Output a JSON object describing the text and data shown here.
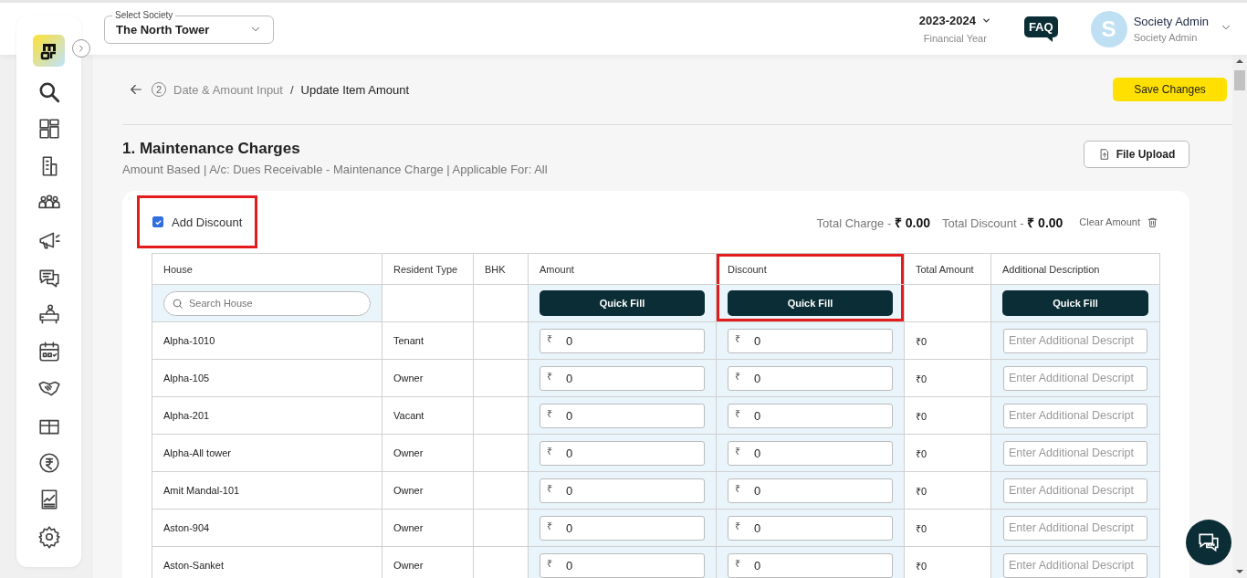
{
  "header": {
    "society_select": {
      "label": "Select Society",
      "value": "The North Tower"
    },
    "year": {
      "value": "2023-2024",
      "caption": "Financial Year"
    },
    "faq": "FAQ",
    "user": {
      "initial": "S",
      "name": "Society Admin",
      "role": "Society Admin"
    }
  },
  "breadcrumb": {
    "step": "2",
    "parent": "Date & Amount Input",
    "separator": "/",
    "current": "Update Item Amount"
  },
  "save_button": "Save Changes",
  "section": {
    "title": "1. Maintenance Charges",
    "subtitle": "Amount Based | A/c: Dues Receivable - Maintenance Charge | Applicable For: All",
    "file_upload": "File Upload"
  },
  "add_discount": {
    "label": "Add Discount",
    "checked": true,
    "highlighted": true
  },
  "totals": {
    "charge": "Total Charge - **₹ 0.00**",
    "discount": "Total Discount - **₹ 0.00**",
    "clear": "Clear Amount"
  },
  "table": {
    "columns": [
      {
        "label": "House",
        "highlighted": false
      },
      {
        "label": "Resident Type",
        "highlighted": false
      },
      {
        "label": "BHK",
        "highlighted": false
      },
      {
        "label": "Amount",
        "highlighted": false
      },
      {
        "label": "Discount",
        "highlighted": true
      },
      {
        "label": "Total Amount",
        "highlighted": false
      },
      {
        "label": "Additional Description",
        "highlighted": false
      }
    ],
    "search_placeholder": "Search House",
    "quick_fill": [
      "Quick Fill",
      "Quick Fill",
      "Quick Fill"
    ],
    "rows": [
      {
        "house": "Alpha-1010",
        "resident_type": "Tenant",
        "amount": {
          "currency": "₹",
          "value": "0"
        },
        "discount": {
          "currency": "₹",
          "value": "0"
        },
        "total": "₹0",
        "description_placeholder": "Enter Additional Descript"
      },
      {
        "house": "Alpha-105",
        "resident_type": "Owner",
        "amount": {
          "currency": "₹",
          "value": "0"
        },
        "discount": {
          "currency": "₹",
          "value": "0"
        },
        "total": "₹0",
        "description_placeholder": "Enter Additional Descript"
      },
      {
        "house": "Alpha-201",
        "resident_type": "Vacant",
        "amount": {
          "currency": "₹",
          "value": "0"
        },
        "discount": {
          "currency": "₹",
          "value": "0"
        },
        "total": "₹0",
        "description_placeholder": "Enter Additional Descript"
      },
      {
        "house": "Alpha-All tower",
        "resident_type": "Owner",
        "amount": {
          "currency": "₹",
          "value": "0"
        },
        "discount": {
          "currency": "₹",
          "value": "0"
        },
        "total": "₹0",
        "description_placeholder": "Enter Additional Descript"
      },
      {
        "house": "Amit Mandal-101",
        "resident_type": "Owner",
        "amount": {
          "currency": "₹",
          "value": "0"
        },
        "discount": {
          "currency": "₹",
          "value": "0"
        },
        "total": "₹0",
        "description_placeholder": "Enter Additional Descript"
      },
      {
        "house": "Aston-904",
        "resident_type": "Owner",
        "amount": {
          "currency": "₹",
          "value": "0"
        },
        "discount": {
          "currency": "₹",
          "value": "0"
        },
        "total": "₹0",
        "description_placeholder": "Enter Additional Descript"
      },
      {
        "house": "Aston-Sanket",
        "resident_type": "Owner",
        "amount": {
          "currency": "₹",
          "value": "0"
        },
        "discount": {
          "currency": "₹",
          "value": "0"
        },
        "total": "₹0",
        "description_placeholder": "Enter Additional Descript"
      }
    ]
  }
}
